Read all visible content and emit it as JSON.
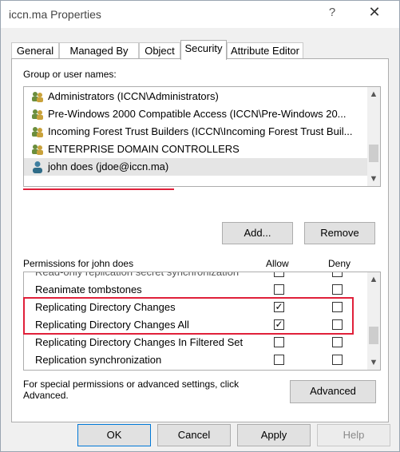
{
  "window": {
    "title": "iccn.ma Properties",
    "help_glyph": "?",
    "close_glyph": "✕"
  },
  "tabs": [
    {
      "label": "General",
      "active": false
    },
    {
      "label": "Managed By",
      "active": false
    },
    {
      "label": "Object",
      "active": false
    },
    {
      "label": "Security",
      "active": true
    },
    {
      "label": "Attribute Editor",
      "active": false
    }
  ],
  "security": {
    "group_label": "Group or user names:",
    "principals": [
      {
        "name": "Administrators (ICCN\\Administrators)",
        "icon": "group-icon",
        "selected": false
      },
      {
        "name": "Pre-Windows 2000 Compatible Access (ICCN\\Pre-Windows 20...",
        "icon": "group-icon",
        "selected": false
      },
      {
        "name": "Incoming Forest Trust Builders (ICCN\\Incoming Forest Trust Buil...",
        "icon": "group-icon",
        "selected": false
      },
      {
        "name": "ENTERPRISE DOMAIN CONTROLLERS",
        "icon": "group-icon",
        "selected": false
      },
      {
        "name": "john does (jdoe@iccn.ma)",
        "icon": "user-icon",
        "selected": true
      }
    ],
    "add_label": "Add...",
    "remove_label": "Remove",
    "permissions_label": "Permissions for john does",
    "allow_header": "Allow",
    "deny_header": "Deny",
    "partial_row": "Read-only replication secret synchronization",
    "permissions": [
      {
        "name": "Reanimate tombstones",
        "allow": false,
        "deny": false
      },
      {
        "name": "Replicating Directory Changes",
        "allow": true,
        "deny": false
      },
      {
        "name": "Replicating Directory Changes All",
        "allow": true,
        "deny": false
      },
      {
        "name": "Replicating Directory Changes In Filtered Set",
        "allow": false,
        "deny": false
      },
      {
        "name": "Replication synchronization",
        "allow": false,
        "deny": false
      }
    ],
    "advanced_hint": "For special permissions or advanced settings, click Advanced.",
    "advanced_label": "Advanced"
  },
  "footer": {
    "ok_label": "OK",
    "cancel_label": "Cancel",
    "apply_label": "Apply",
    "help_label": "Help"
  },
  "colors": {
    "highlight_red": "#e0203a",
    "dialog_bg": "#f0f0f0"
  }
}
